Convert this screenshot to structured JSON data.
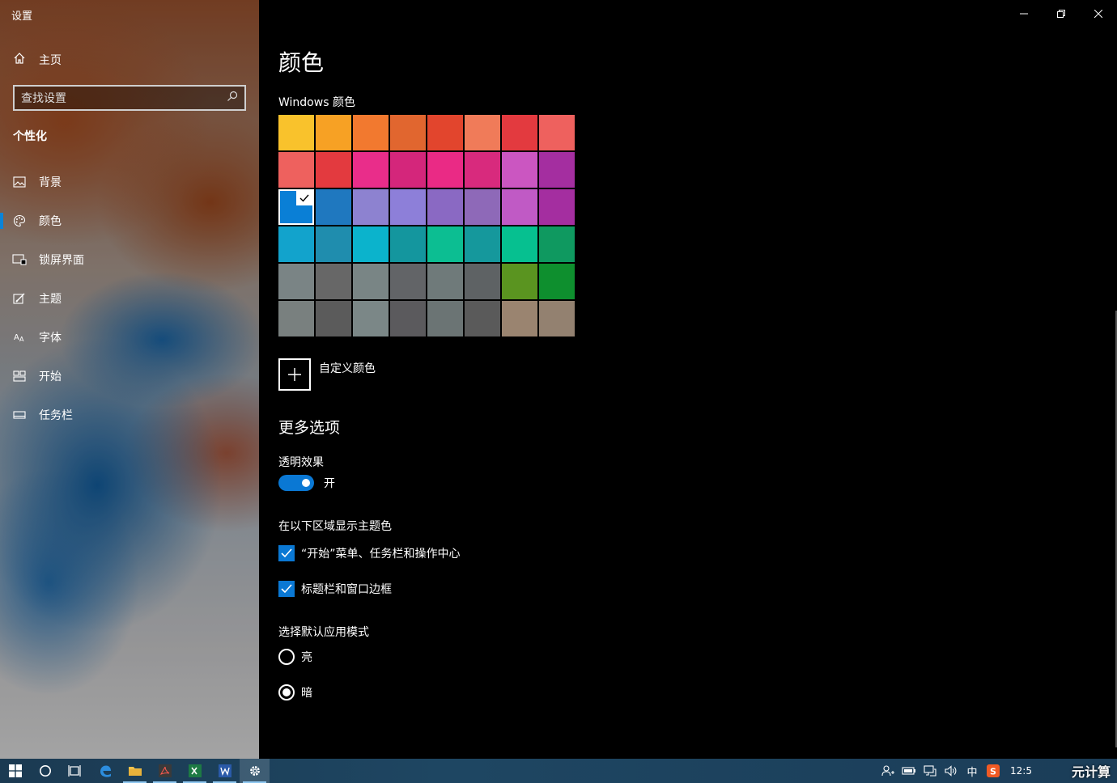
{
  "window": {
    "title": "设置"
  },
  "sidebar": {
    "home_label": "主页",
    "search_placeholder": "查找设置",
    "section_title": "个性化",
    "items": [
      {
        "label": "背景",
        "icon": "picture-icon"
      },
      {
        "label": "颜色",
        "icon": "palette-icon",
        "active": true
      },
      {
        "label": "锁屏界面",
        "icon": "lockscreen-icon"
      },
      {
        "label": "主题",
        "icon": "theme-icon"
      },
      {
        "label": "字体",
        "icon": "font-icon"
      },
      {
        "label": "开始",
        "icon": "start-icon"
      },
      {
        "label": "任务栏",
        "icon": "taskbar-icon"
      }
    ]
  },
  "main": {
    "title": "颜色",
    "windows_colors_label": "Windows 颜色",
    "swatches": [
      "#f9c22c",
      "#f7a124",
      "#f2792f",
      "#e1662f",
      "#e2452d",
      "#f07b59",
      "#e33a3f",
      "#ee615e",
      "#ee615e",
      "#e33a3f",
      "#e92d8a",
      "#d4267b",
      "#ea2a85",
      "#d82a7d",
      "#cb56c1",
      "#a42ea0",
      "#0a7fd6",
      "#1f78bf",
      "#8d82d0",
      "#8d7fd9",
      "#8a69c3",
      "#8e69b8",
      "#c05ac5",
      "#a42ea0",
      "#12a3cc",
      "#1f8dae",
      "#0bb3cc",
      "#14969e",
      "#0cbe92",
      "#15989c",
      "#06c090",
      "#0f9960",
      "#7a8485",
      "#676767",
      "#798585",
      "#626467",
      "#6f7a7a",
      "#5e6264",
      "#5a9420",
      "#0e8f2e",
      "#79807f",
      "#5b5b5b",
      "#7b8787",
      "#5b5a5d",
      "#6b7474",
      "#5a5a5a",
      "#9a8470",
      "#938170"
    ],
    "selected_swatch_index": 16,
    "custom_color_label": "自定义颜色",
    "more_options_title": "更多选项",
    "transparency_label": "透明效果",
    "transparency_state": "开",
    "accent_surfaces_label": "在以下区域显示主题色",
    "checkbox_start": "“开始”菜单、任务栏和操作中心",
    "checkbox_titlebar": "标题栏和窗口边框",
    "app_mode_label": "选择默认应用模式",
    "mode_light": "亮",
    "mode_dark": "暗",
    "selected_mode": "暗"
  },
  "taskbar": {
    "ime": "中",
    "clock": "12:5",
    "watermark": "元计算"
  },
  "colors": {
    "accent": "#0a78d4"
  }
}
